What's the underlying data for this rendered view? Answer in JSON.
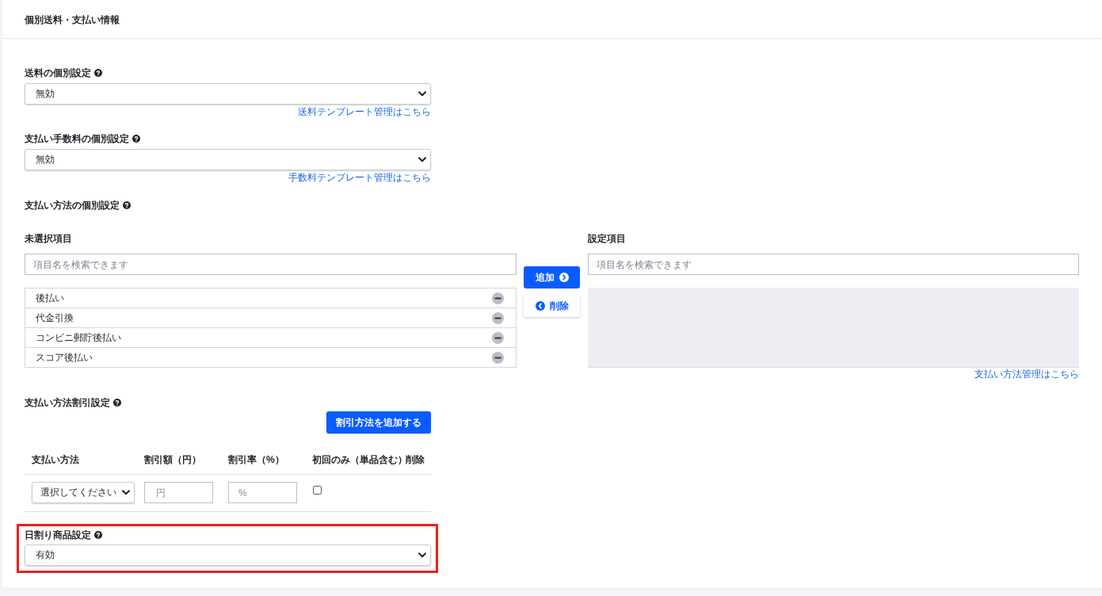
{
  "header": {
    "title": "個別送料・支払い情報"
  },
  "shipping_fee": {
    "label": "送料の個別設定",
    "value": "無効",
    "link": "送料テンプレート管理はこちら"
  },
  "payment_fee": {
    "label": "支払い手数料の個別設定",
    "value": "無効",
    "link": "手数料テンプレート管理はこちら"
  },
  "payment_methods": {
    "label": "支払い方法の個別設定",
    "unselected": {
      "heading": "未選択項目",
      "search": {
        "placeholder": "項目名を検索できます"
      },
      "items": [
        "後払い",
        "代金引換",
        "コンビニ郵貯後払い",
        "スコア後払い"
      ]
    },
    "add_button": "追加",
    "remove_button": "削除",
    "selected": {
      "heading": "設定項目",
      "search": {
        "placeholder": "項目名を検索できます"
      }
    },
    "link": "支払い方法管理はこちら"
  },
  "discount": {
    "label": "支払い方法割引設定",
    "add_button": "割引方法を追加する",
    "columns": [
      "支払い方法",
      "割引額（円）",
      "割引率（%）",
      "初回のみ（単品含む）",
      "削除"
    ],
    "rows": [
      {
        "method": "選択してください",
        "amount": {
          "placeholder": "円"
        },
        "rate": {
          "placeholder": "%"
        },
        "first_only": false
      }
    ]
  },
  "daily_proration": {
    "label": "日割り商品設定",
    "value": "有効",
    "highlighted": true
  }
}
